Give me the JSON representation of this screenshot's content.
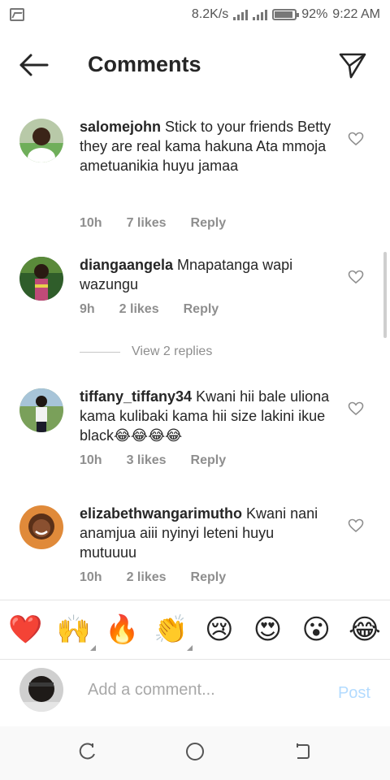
{
  "status_bar": {
    "speed": "8.2K/s",
    "battery_percent": "92%",
    "time": "9:22 AM",
    "battery_level": 0.92
  },
  "header": {
    "title": "Comments"
  },
  "comments": [
    {
      "username": "salomejohn",
      "text": "Stick to your friends Betty they are real kama hakuna Ata mmoja ametuanikia huyu jamaa",
      "time": "10h",
      "likes": "7 likes",
      "reply": "Reply"
    },
    {
      "username": "diangaangela",
      "text": "Mnapatanga wapi wazungu",
      "time": "9h",
      "likes": "2 likes",
      "reply": "Reply",
      "view_replies": "View 2 replies"
    },
    {
      "username": "tiffany_tiffany34",
      "text": "Kwani hii bale uliona kama kulibaki kama hii size lakini ikue black😂😂😂😂",
      "time": "10h",
      "likes": "3 likes",
      "reply": "Reply"
    },
    {
      "username": "elizabethwangarimutho",
      "text": "Kwani nani anamjua aiii nyinyi leteni huyu mutuuuu",
      "time": "10h",
      "likes": "2 likes",
      "reply": "Reply"
    }
  ],
  "emoji_bar": [
    "❤️",
    "🙌",
    "🔥",
    "👏",
    "😢",
    "😍",
    "😮",
    "😂"
  ],
  "add_comment": {
    "placeholder": "Add a comment...",
    "post_label": "Post"
  },
  "colors": {
    "text": "#262626",
    "secondary": "#8e8e8e",
    "post_disabled": "#b3dbff"
  }
}
